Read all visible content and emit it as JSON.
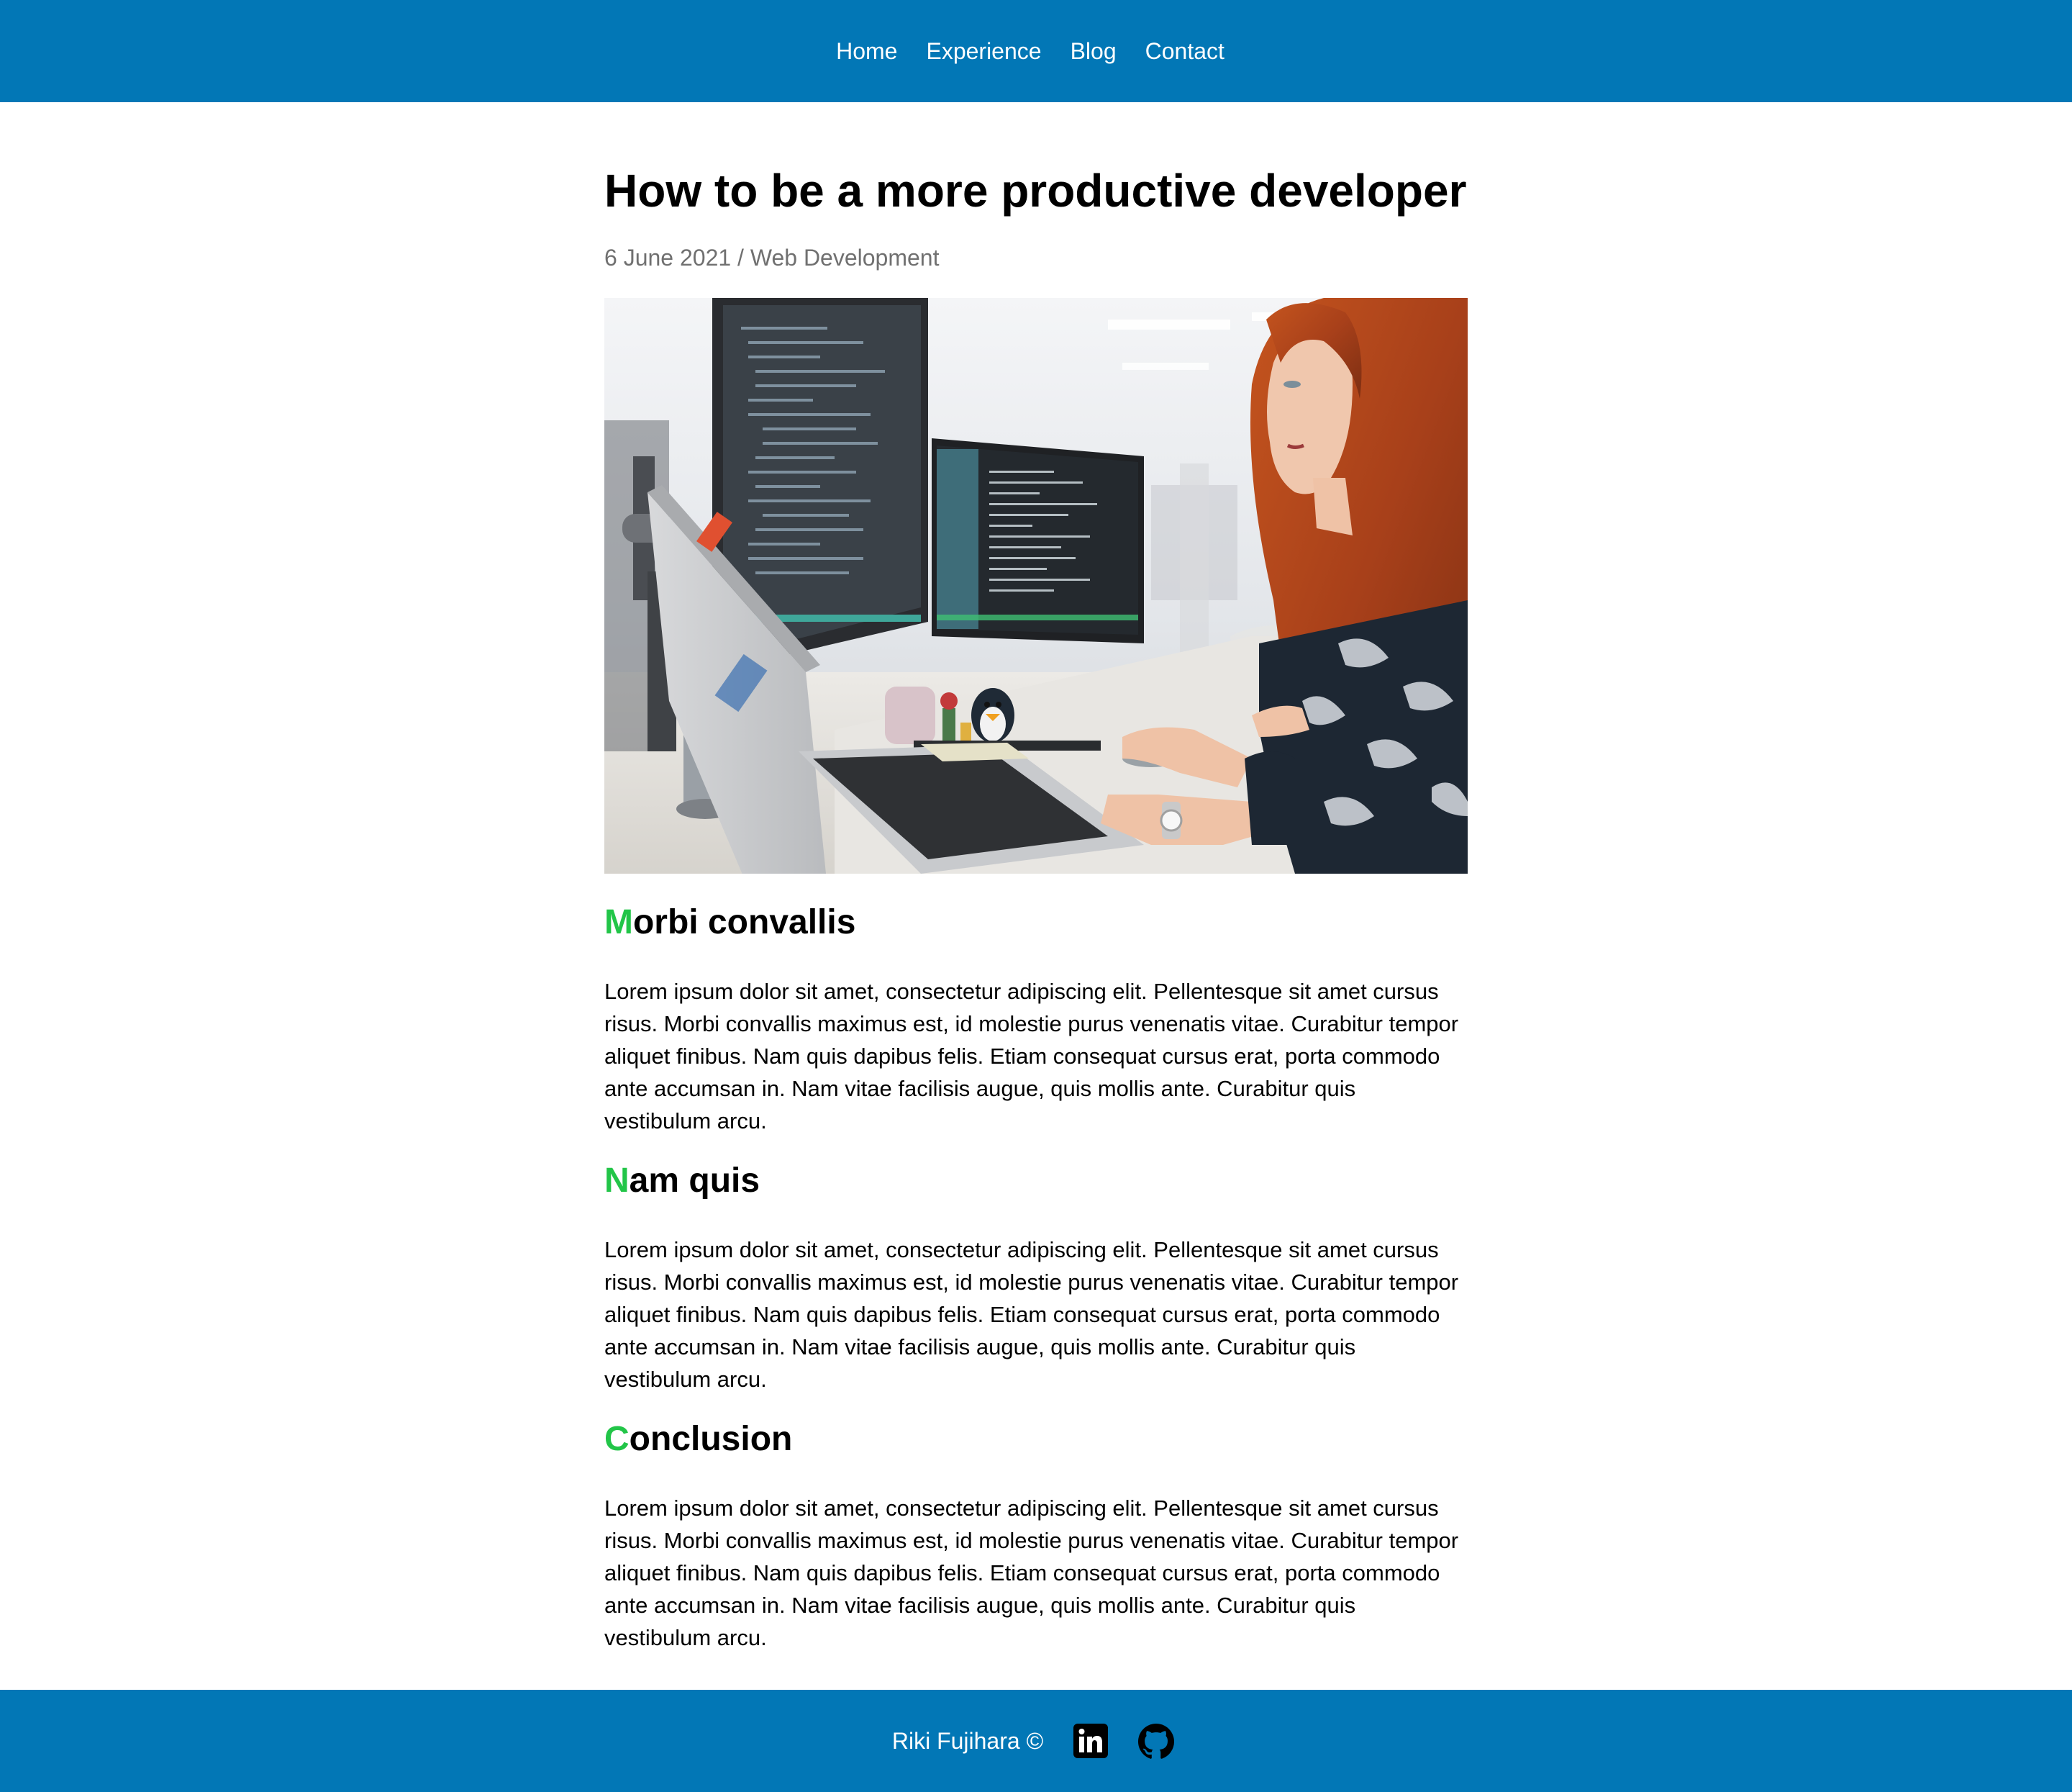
{
  "nav": {
    "items": [
      {
        "label": "Home"
      },
      {
        "label": "Experience"
      },
      {
        "label": "Blog"
      },
      {
        "label": "Contact"
      }
    ]
  },
  "post": {
    "title": "How to be a more productive developer",
    "date": "6 June 2021",
    "separator": "/",
    "category": "Web Development",
    "sections": [
      {
        "accent": "M",
        "heading_rest": "orbi convallis",
        "body": "Lorem ipsum dolor sit amet, consectetur adipiscing elit. Pellentesque sit amet cursus risus. Morbi convallis maximus est, id molestie purus venenatis vitae. Curabitur tempor aliquet finibus. Nam quis dapibus felis. Etiam consequat cursus erat, porta commodo ante accumsan in. Nam vitae facilisis augue, quis mollis ante. Curabitur quis vestibulum arcu."
      },
      {
        "accent": "N",
        "heading_rest": "am quis",
        "body": "Lorem ipsum dolor sit amet, consectetur adipiscing elit. Pellentesque sit amet cursus risus. Morbi convallis maximus est, id molestie purus venenatis vitae. Curabitur tempor aliquet finibus. Nam quis dapibus felis. Etiam consequat cursus erat, porta commodo ante accumsan in. Nam vitae facilisis augue, quis mollis ante. Curabitur quis vestibulum arcu."
      },
      {
        "accent": "C",
        "heading_rest": "onclusion",
        "body": "Lorem ipsum dolor sit amet, consectetur adipiscing elit. Pellentesque sit amet cursus risus. Morbi convallis maximus est, id molestie purus venenatis vitae. Curabitur tempor aliquet finibus. Nam quis dapibus felis. Etiam consequat cursus erat, porta commodo ante accumsan in. Nam vitae facilisis augue, quis mollis ante. Curabitur quis vestibulum arcu."
      }
    ]
  },
  "footer": {
    "copyright": "Riki Fujihara ©",
    "icons": [
      "linkedin-icon",
      "github-icon"
    ]
  },
  "colors": {
    "brand_blue": "#0277b6",
    "accent_green": "#22c548",
    "meta_gray": "#707070"
  }
}
